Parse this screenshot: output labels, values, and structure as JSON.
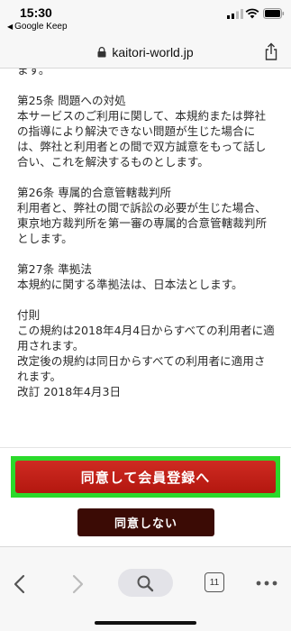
{
  "status_bar": {
    "time": "15:30",
    "back_app": "Google Keep",
    "icons": [
      "signal-icon",
      "wifi-icon",
      "battery-icon"
    ]
  },
  "url_bar": {
    "url": "kaitori-world.jp",
    "icons": [
      "lock-icon",
      "share-icon"
    ]
  },
  "content": {
    "clipped_line": "ます。",
    "sections": [
      {
        "heading": "第25条 問題への対処",
        "body": "本サービスのご利用に関して、本規約または弊社の指導により解決できない問題が生じた場合には、弊社と利用者との間で双方誠意をもって話し合い、これを解決するものとします。"
      },
      {
        "heading": "第26条 専属的合意管轄裁判所",
        "body": "利用者と、弊社の間で訴訟の必要が生じた場合、東京地方裁判所を第一審の専属的合意管轄裁判所とします。"
      },
      {
        "heading": "第27条 準拠法",
        "body": "本規約に関する準拠法は、日本法とします。"
      }
    ],
    "appendix": {
      "heading": "付則",
      "line1": "この規約は2018年4月4日からすべての利用者に適用されます。",
      "line2": "改定後の規約は同日からすべての利用者に適用されます。",
      "line3": "改訂 2018年4月3日"
    }
  },
  "buttons": {
    "agree_label": "同意して会員登録へ",
    "disagree_label": "同意しない",
    "agree_color": "#c4211a",
    "highlight_color": "#2bd92b",
    "disagree_color": "#3b0b05"
  },
  "toolbar": {
    "tab_count": "11",
    "icons": [
      "back-icon",
      "forward-icon",
      "search-icon",
      "tabs-icon",
      "more-icon"
    ]
  }
}
